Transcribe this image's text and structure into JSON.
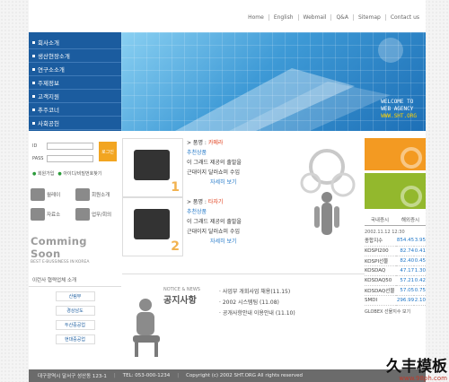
{
  "topnav": [
    "Home",
    "English",
    "Webmail",
    "Q&A",
    "Sitemap",
    "Contact us"
  ],
  "menu": [
    "회사소개",
    "생산현장소개",
    "연구소소개",
    "주제정보",
    "고객지원",
    "추주코너",
    "사회공헌"
  ],
  "hero": {
    "line1": "WELCOME TO",
    "line2": "WEB AGENCY",
    "url": "WWW.SHT.ORG"
  },
  "login": {
    "id_label": "ID",
    "pw_label": "PASS",
    "button": "로그인",
    "link1": "회원가입",
    "link2": "아이디/비밀번호찾기"
  },
  "shortcuts": [
    "월레이",
    "회원소개",
    "자료소",
    "업무/회의"
  ],
  "coming": {
    "big": "Comming Soon",
    "sub": "BEST E-BUSSINESS IN KOREA"
  },
  "banners": {
    "title": "이런사 협력업체 소개",
    "items": [
      "산림부",
      "경상남도",
      "두산중공업",
      "현대중공업"
    ]
  },
  "products": [
    {
      "num": "1",
      "name": "카메라",
      "brand": "추천상품",
      "line1": "이 그래드 제공의 출발을",
      "line2": "근대이지 달러쇼미 수입",
      "more": "자세히 보기"
    },
    {
      "num": "2",
      "name": "타자기",
      "brand": "추천상품",
      "line1": "이 그래드 제공의 출발을",
      "line2": "근대이지 달러쇼미 수입",
      "more": "자세히 보기"
    }
  ],
  "stocks": {
    "tabs": [
      "국내증시",
      "해외증시"
    ],
    "date": "2002.11.12 12:30",
    "rows": [
      {
        "name": "종합지수",
        "value": "854.45",
        "change": "3.95"
      },
      {
        "name": "KOSPI200",
        "value": "82.74",
        "change": "0.41"
      },
      {
        "name": "KOSPI선물",
        "value": "82.40",
        "change": "0.45"
      },
      {
        "name": "KOSDAQ",
        "value": "47.17",
        "change": "1.30"
      },
      {
        "name": "KOSDAQ50",
        "value": "57.21",
        "change": "0.42"
      },
      {
        "name": "KOSDAQ선물",
        "value": "57.05",
        "change": "0.75"
      },
      {
        "name": "SMDI",
        "value": "296.99",
        "change": "2.10"
      }
    ],
    "more": "GLOBEX 선물지수 보기"
  },
  "notice": {
    "en": "NOTICE & NEWS",
    "ko": "공지사항",
    "items": [
      "사업부 개회사업 채용(11.15)",
      "2002 시스템팀 (11.08)",
      "공개사항안내 이용안내 (11.10)"
    ]
  },
  "footer": {
    "address": "대구광역시 달서구 성산동 123-1",
    "tel": "TEL: 053-000-1234",
    "copyright": "Copyright (c) 2002 SHT.ORG All rights reserved"
  },
  "watermark": {
    "text": "久丰模板",
    "url": "www.98ph.com"
  },
  "colors": {
    "menu_bg": "#1b5c9f",
    "accent_orange": "#f39a22",
    "accent_green": "#93b82d",
    "footer_bg": "#6b6b6b"
  }
}
